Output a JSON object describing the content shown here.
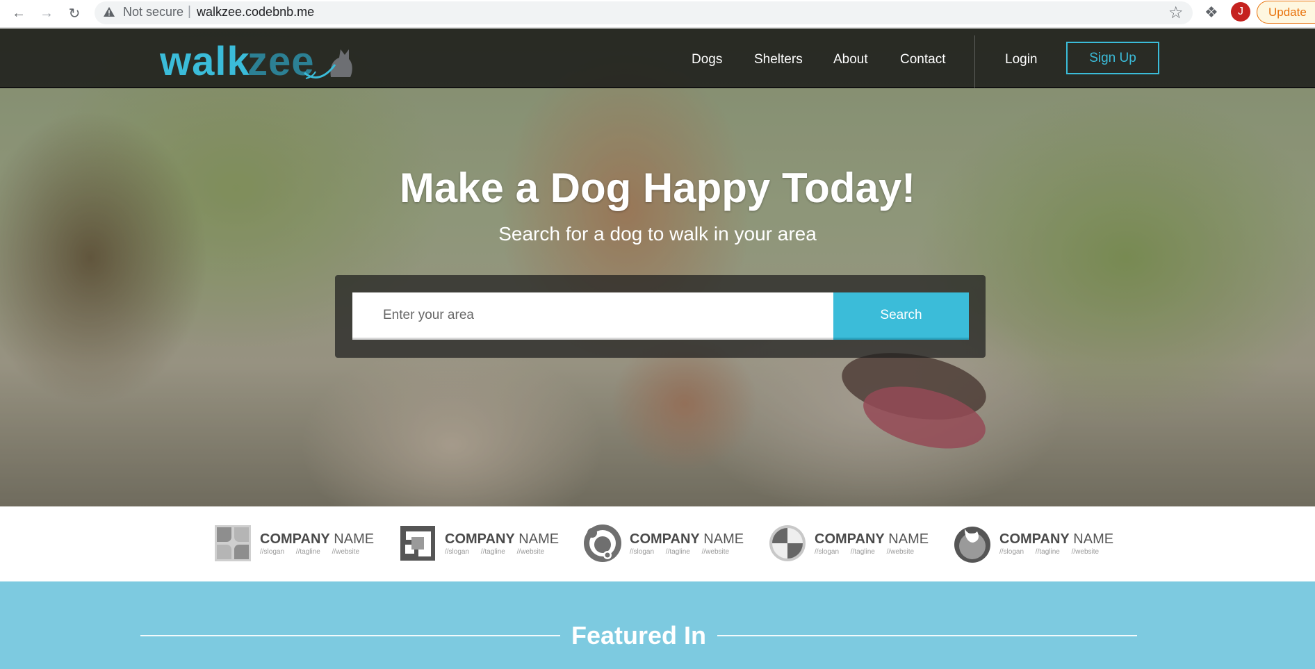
{
  "browser": {
    "security_label": "Not secure",
    "separator": "|",
    "url": "walkzee.codebnb.me",
    "profile_initial": "J",
    "update_label": "Update"
  },
  "site": {
    "logo": {
      "part1": "walk",
      "part2": "zee"
    },
    "nav": [
      {
        "label": "Dogs"
      },
      {
        "label": "Shelters"
      },
      {
        "label": "About"
      },
      {
        "label": "Contact"
      }
    ],
    "login_label": "Login",
    "signup_label": "Sign Up",
    "accent": "#3bbcd9"
  },
  "hero": {
    "title": "Make a Dog Happy Today!",
    "subtitle": "Search for a dog to walk in your area",
    "search": {
      "placeholder": "Enter your area",
      "value": "",
      "button_label": "Search"
    }
  },
  "partners": [
    {
      "name_bold": "COMPANY",
      "name_rest": " NAME",
      "meta": "//slogan //tagline //website",
      "icon": "quad-leaf-icon"
    },
    {
      "name_bold": "COMPANY",
      "name_rest": " NAME",
      "meta": "//slogan //tagline //website",
      "icon": "nested-squares-icon"
    },
    {
      "name_bold": "COMPANY",
      "name_rest": " NAME",
      "meta": "//slogan //tagline //website",
      "icon": "circles-icon"
    },
    {
      "name_bold": "COMPANY",
      "name_rest": " NAME",
      "meta": "//slogan //tagline //website",
      "icon": "quartered-circle-icon"
    },
    {
      "name_bold": "COMPANY",
      "name_rest": " NAME",
      "meta": "//slogan //tagline //website",
      "icon": "flame-circle-icon"
    }
  ],
  "featured": {
    "title": "Featured In",
    "background": "#7dcae0"
  }
}
